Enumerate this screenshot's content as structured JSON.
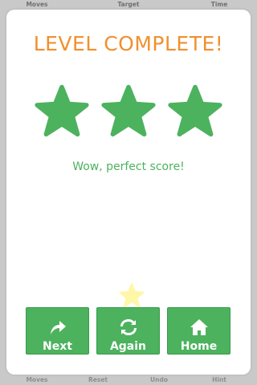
{
  "status_bar": {
    "top": [
      "Moves",
      "Target",
      "Time"
    ],
    "bottom": [
      "Moves",
      "Reset",
      "Undo",
      "Hint"
    ]
  },
  "dialog": {
    "title": "LEVEL COMPLETE!",
    "stars_earned": 3,
    "stars_total": 3,
    "message": "Wow, perfect score!"
  },
  "buttons": {
    "next": {
      "label": "Next",
      "icon": "share-arrow-icon"
    },
    "again": {
      "label": "Again",
      "icon": "refresh-icon"
    },
    "home": {
      "label": "Home",
      "icon": "house-icon"
    }
  },
  "colors": {
    "title": "#f0902e",
    "star": "#4cb25e",
    "message": "#4cb25e",
    "button": "#4cb25e",
    "bonus_star": "#fff7a8",
    "background": "#c9c9c9"
  }
}
